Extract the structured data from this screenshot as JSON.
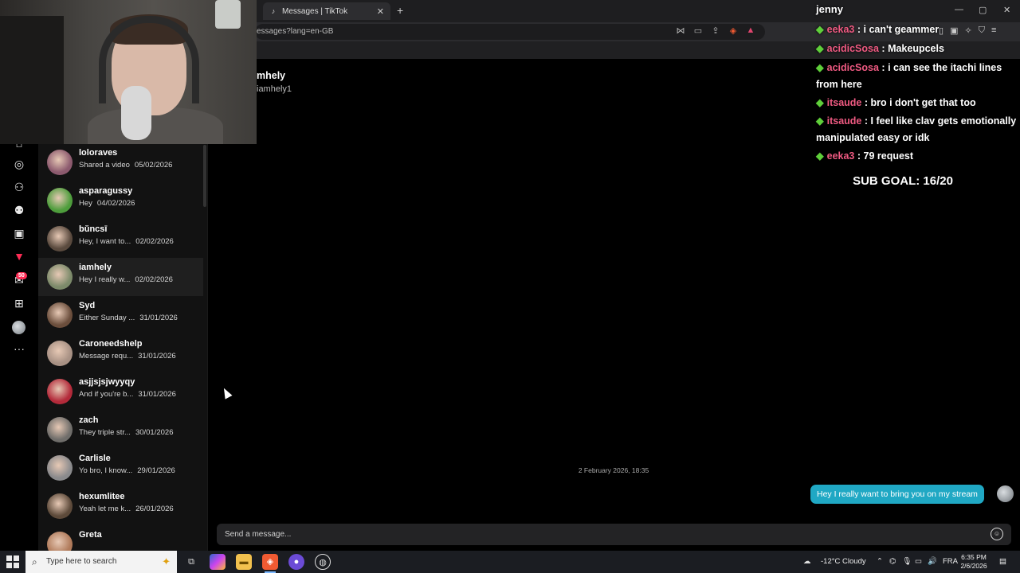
{
  "browser": {
    "tab_title": "Messages | TikTok",
    "tab_close": "✕",
    "new_tab": "+",
    "url": "essages?lang=en-GB",
    "window_controls": [
      "—",
      "▢",
      "✕"
    ]
  },
  "nav_rail": {
    "inbox_badge": "50",
    "icons": [
      "home-icon",
      "explore-icon",
      "following-icon",
      "friends-icon",
      "live-icon",
      "activity-icon",
      "messages-icon",
      "upload-icon",
      "profile-avatar",
      "more-icon"
    ]
  },
  "conversations": [
    {
      "name": "loloraves",
      "preview": "Shared a video",
      "date": "05/02/2026",
      "color": "#8c5a6e"
    },
    {
      "name": "asparagussy",
      "preview": "Hey",
      "date": "04/02/2026",
      "color": "#4e9d3c"
    },
    {
      "name": "bŭncsī",
      "preview": "Hey, I want to...",
      "date": "02/02/2026",
      "color": "#5a4a3e"
    },
    {
      "name": "iamhely",
      "preview": "Hey I really w...",
      "date": "02/02/2026",
      "color": "#7c8a6a"
    },
    {
      "name": "Syd",
      "preview": "Either Sunday ...",
      "date": "31/01/2026",
      "color": "#6b4e3c"
    },
    {
      "name": "Caroneedshelp",
      "preview": "Message requ...",
      "date": "31/01/2026",
      "color": "#a89184"
    },
    {
      "name": "asjjsjsjwyyqy",
      "preview": "And if you're b...",
      "date": "31/01/2026",
      "color": "#b32a3a"
    },
    {
      "name": "zach",
      "preview": "They triple str...",
      "date": "30/01/2026",
      "color": "#6f6d6a"
    },
    {
      "name": "Carlisle",
      "preview": "Yo bro, I know...",
      "date": "29/01/2026",
      "color": "#8a8a8c"
    },
    {
      "name": "hexumlitee",
      "preview": "Yeah let me k...",
      "date": "26/01/2026",
      "color": "#5d4a3a"
    },
    {
      "name": "Greta",
      "preview": "",
      "date": "",
      "color": "#b07a5a"
    }
  ],
  "chat": {
    "name": "mhely",
    "handle": "iamhely1",
    "timestamp": "2 February 2026, 18:35",
    "message": "Hey I really want to bring you on my stream",
    "composer_placeholder": "Send a message..."
  },
  "stream_overlay": {
    "username": "jenny",
    "messages": [
      {
        "user": "eeka3",
        "text": "i can't geammer",
        "user_color": "#f05a82"
      },
      {
        "user": "acidicSosa",
        "text": "Makeupcels",
        "user_color": "#f05a82"
      },
      {
        "user": "acidicSosa",
        "text": "i can see the itachi lines from here",
        "user_color": "#f05a82"
      },
      {
        "user": "itsaude",
        "text": "bro i don't get that too",
        "user_color": "#f05a82"
      },
      {
        "user": "itsaude",
        "text": "I feel like clav gets emotionally manipulated easy or idk",
        "user_color": "#f05a82"
      },
      {
        "user": "eeka3",
        "text": "79 request",
        "user_color": "#f05a82"
      }
    ],
    "sub_goal": "SUB GOAL: 16/20"
  },
  "taskbar": {
    "search_placeholder": "Type here to search",
    "weather": "-12°C  Cloudy",
    "language": "FRA",
    "time": "6:35 PM",
    "date": "2/6/2026"
  },
  "colors": {
    "accent": "#20a8c4",
    "badge": "#fe2c55",
    "gem": "#5fcf3a"
  }
}
